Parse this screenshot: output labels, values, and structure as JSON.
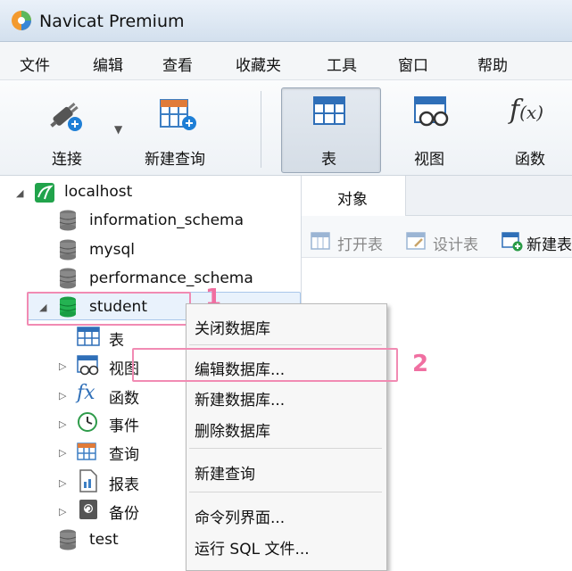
{
  "window": {
    "title": "Navicat Premium"
  },
  "menu": [
    "文件",
    "编辑",
    "查看",
    "收藏夹",
    "工具",
    "窗口",
    "帮助"
  ],
  "toolbar": {
    "connect": "连接",
    "new_query": "新建查询",
    "table": "表",
    "view": "视图",
    "function": "函数"
  },
  "tree": {
    "connection": "localhost",
    "databases": [
      "information_schema",
      "mysql",
      "performance_schema",
      "student",
      "test"
    ],
    "student_children": [
      "表",
      "视图",
      "函数",
      "事件",
      "查询",
      "报表",
      "备份"
    ]
  },
  "object_tab": {
    "label": "对象"
  },
  "object_toolbar": {
    "open_table": "打开表",
    "design_table": "设计表",
    "new_table": "新建表"
  },
  "context_menu": [
    "关闭数据库",
    "编辑数据库...",
    "新建数据库...",
    "删除数据库",
    "新建查询",
    "命令列界面...",
    "运行 SQL 文件..."
  ],
  "annotations": {
    "step1": "1",
    "step2": "2"
  },
  "colors": {
    "highlight": "#f18bb3",
    "badge": "#f06fa1",
    "selection": "#e9f2fc",
    "db_active": "#1aa34a"
  }
}
